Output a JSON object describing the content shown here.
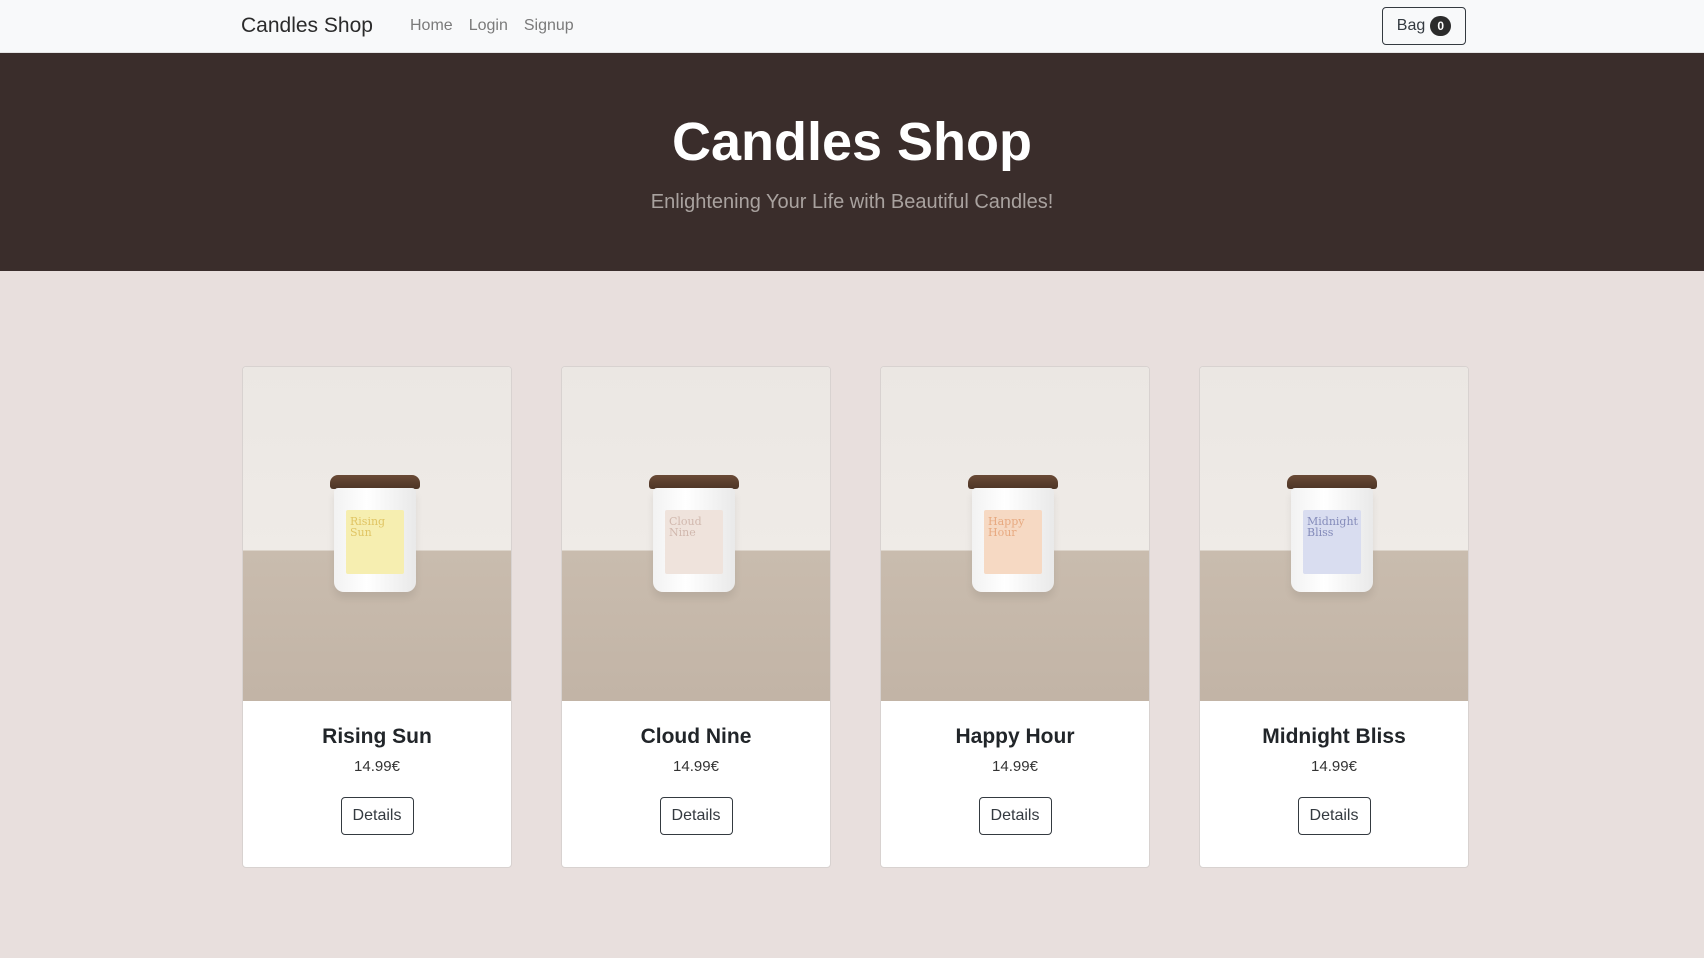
{
  "nav": {
    "brand": "Candles Shop",
    "links": [
      "Home",
      "Login",
      "Signup"
    ],
    "bag_label": "Bag",
    "bag_count": "0"
  },
  "hero": {
    "title": "Candles Shop",
    "subtitle": "Enlightening Your Life with Beautiful Candles!"
  },
  "products": [
    {
      "name": "Rising Sun",
      "price": "14.99€",
      "button": "Details",
      "label_text": "Rising Sun",
      "label_color": "#f6eeb0",
      "label_text_color": "#d9b74a"
    },
    {
      "name": "Cloud Nine",
      "price": "14.99€",
      "button": "Details",
      "label_text": "Cloud Nine",
      "label_color": "#efe3dc",
      "label_text_color": "#c7aa9f"
    },
    {
      "name": "Happy Hour",
      "price": "14.99€",
      "button": "Details",
      "label_text": "Happy Hour",
      "label_color": "#f6d9c3",
      "label_text_color": "#e39a6a"
    },
    {
      "name": "Midnight Bliss",
      "price": "14.99€",
      "button": "Details",
      "label_text": "Midnight Bliss",
      "label_color": "#d9ddf0",
      "label_text_color": "#6870a8"
    }
  ]
}
